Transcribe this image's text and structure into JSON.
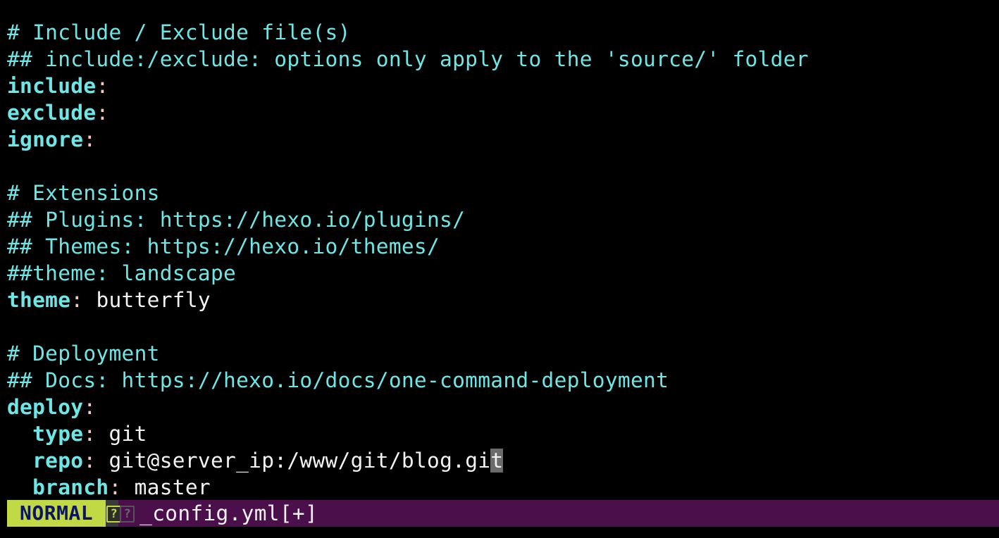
{
  "editor": {
    "lines": {
      "l1": "# Include / Exclude file(s)",
      "l2": "## include:/exclude: options only apply to the 'source/' folder",
      "l3_key": "include",
      "l4_key": "exclude",
      "l5_key": "ignore",
      "l7": "# Extensions",
      "l8": "## Plugins: https://hexo.io/plugins/",
      "l9": "## Themes: https://hexo.io/themes/",
      "l10": "##theme: landscape",
      "l11_key": "theme",
      "l11_val": "butterfly",
      "l13": "# Deployment",
      "l14": "## Docs: https://hexo.io/docs/one-command-deployment",
      "l15_key": "deploy",
      "l16_key": "type",
      "l16_val": "git",
      "l17_key": "repo",
      "l17_val_before_cursor": "git@server_ip:/www/git/blog.gi",
      "l17_cursor_char": "t",
      "l18_key": "branch",
      "l18_val": "master"
    },
    "colon": ":",
    "indent": "  "
  },
  "statusbar": {
    "mode": "NORMAL",
    "icon_glyph": "?",
    "filename": "_config.yml[+]"
  },
  "colors": {
    "comment": "#6fe6e6",
    "key": "#6fe6e6",
    "colon": "#f3c9c9",
    "value": "#f2f2f2",
    "mode_bg": "#c0d944",
    "mode_fg": "#0b1560",
    "statusbar_bg": "#4b0f4b",
    "cursor_bg": "#6b6b6b"
  }
}
